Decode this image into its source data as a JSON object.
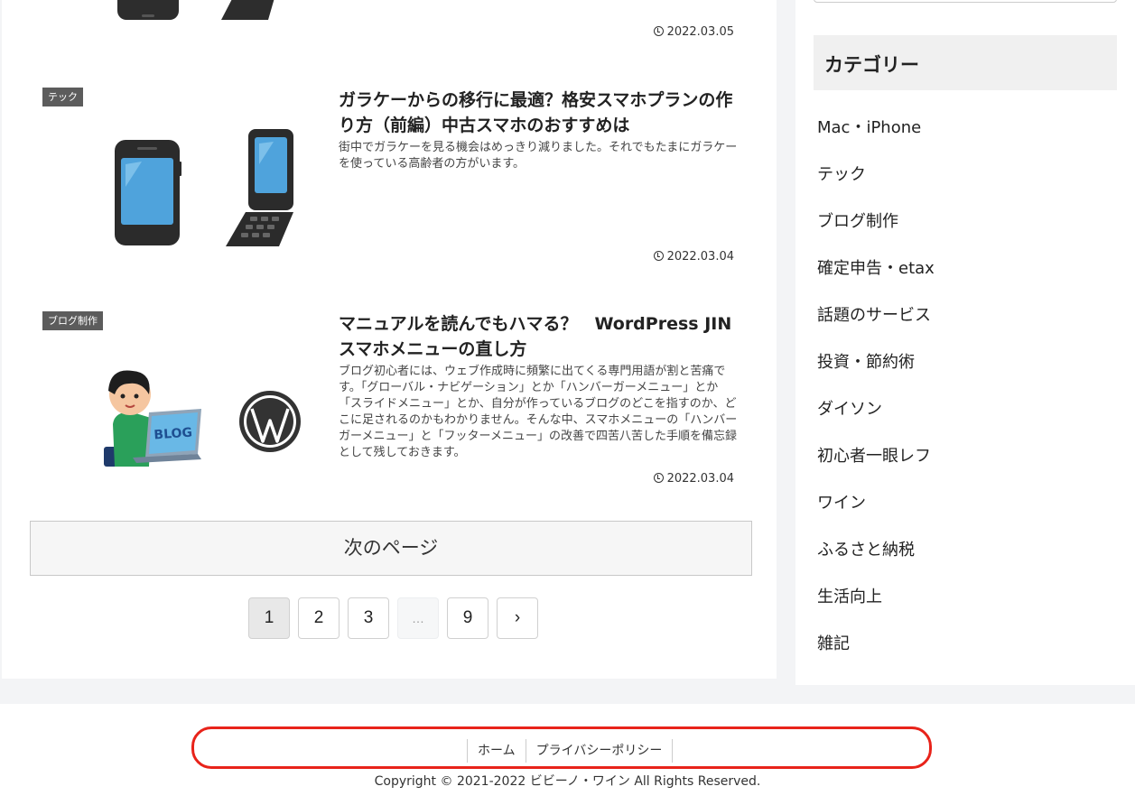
{
  "articles": [
    {
      "date": "2022.03.05"
    },
    {
      "tag": "テック",
      "title": "ガラケーからの移行に最適？格安スマホプランの作り方（前編）中古スマホのおすすめは",
      "excerpt": "街中でガラケーを見る機会はめっきり減りました。それでもたまにガラケーを使っている高齢者の方がいます。",
      "date": "2022.03.04"
    },
    {
      "tag": "ブログ制作",
      "title": "マニュアルを読んでもハマる？　WordPress JIN スマホメニューの直し方",
      "excerpt": "ブログ初心者には、ウェブ作成時に頻繁に出てくる専門用語が割と苦痛です。「グローバル・ナビゲーション」とか「ハンバーガーメニュー」とか「スライドメニュー」とか、自分が作っているブログのどこを指すのか、どこに足されるのかもわかりません。そんな中、スマホメニューの「ハンバーガーメニュー」と「フッターメニュー」の改善で四苦八苦した手順を備忘録として残しておきます。",
      "date": "2022.03.04",
      "thumb_text": "BLOG"
    }
  ],
  "next_page_label": "次のページ",
  "pagination": [
    "1",
    "2",
    "3",
    "…",
    "9",
    "›"
  ],
  "sidebar": {
    "heading": "カテゴリー",
    "categories": [
      "Mac・iPhone",
      "テック",
      "ブログ制作",
      "確定申告・etax",
      "話題のサービス",
      "投資・節約術",
      "ダイソン",
      "初心者一眼レフ",
      "ワイン",
      "ふるさと納税",
      "生活向上",
      "雑記"
    ]
  },
  "footer": {
    "nav": [
      "ホーム",
      "プライバシーポリシー"
    ],
    "copyright": "Copyright © 2021-2022 ビビーノ・ワイン All Rights Reserved."
  },
  "colors": {
    "highlight": "#e8231a",
    "phone_screen": "#4fa3dc"
  }
}
